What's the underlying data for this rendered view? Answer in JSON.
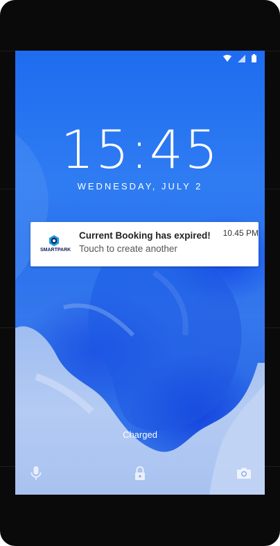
{
  "status_bar": {
    "icons": [
      "wifi-icon",
      "cell-signal-icon",
      "battery-icon"
    ]
  },
  "lockscreen": {
    "time": "15:45",
    "date": "WEDNESDAY, JULY 2",
    "charging_status": "Charged"
  },
  "notification": {
    "app_name": "SMARTPARK",
    "title": "Current Booking has expired!",
    "text": "Touch to create another",
    "time": "10.45 PM"
  },
  "bottom_actions": {
    "icons": [
      "microphone-icon",
      "lock-icon",
      "camera-icon"
    ]
  },
  "colors": {
    "wallpaper_blue": "#2f7cf2",
    "wallpaper_pale": "#a9c4f2",
    "notification_bg": "#ffffff",
    "device_frame": "#0a0a0a"
  }
}
